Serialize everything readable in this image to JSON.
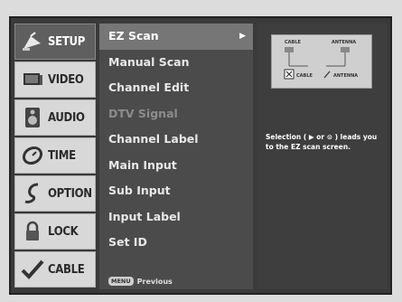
{
  "categories": [
    {
      "label": "SETUP",
      "icon": "satellite-dish-icon"
    },
    {
      "label": "VIDEO",
      "icon": "tv-screen-icon"
    },
    {
      "label": "AUDIO",
      "icon": "speaker-icon"
    },
    {
      "label": "TIME",
      "icon": "clock-icon"
    },
    {
      "label": "OPTION",
      "icon": "option-hook-icon"
    },
    {
      "label": "LOCK",
      "icon": "padlock-icon"
    },
    {
      "label": "CABLE",
      "icon": "checkmark-icon"
    }
  ],
  "menu": {
    "items": [
      {
        "label": "EZ Scan",
        "state": "selected",
        "arrow": "▶"
      },
      {
        "label": "Manual Scan",
        "state": "normal"
      },
      {
        "label": "Channel Edit",
        "state": "normal"
      },
      {
        "label": "DTV Signal",
        "state": "disabled"
      },
      {
        "label": "Channel Label",
        "state": "normal"
      },
      {
        "label": "Main Input",
        "state": "normal"
      },
      {
        "label": "Sub Input",
        "state": "normal"
      },
      {
        "label": "Input Label",
        "state": "normal"
      },
      {
        "label": "Set ID",
        "state": "normal"
      }
    ],
    "footer": {
      "key": "MENU",
      "label": "Previous"
    }
  },
  "panel": {
    "diagram": {
      "top_left_label": "CABLE",
      "top_right_label": "ANTENNA",
      "bottom_cable_label": "CABLE",
      "bottom_antenna_label": "ANTENNA"
    },
    "description": "Selection ( ▶ or ⊙ ) leads you to the EZ scan screen."
  },
  "colors": {
    "active_category_bg": "#5f5f5f",
    "category_bg": "#d8d8d8",
    "menu_bg": "#4b4b4b",
    "selected_item_bg": "#767676"
  }
}
